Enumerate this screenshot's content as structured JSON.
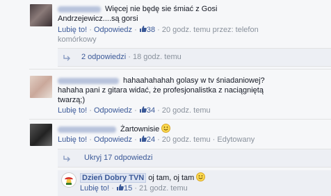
{
  "comments": [
    {
      "text_line1": "Więcej nie będę sie śmiać z Gosi",
      "text_line2": "Andrzejewicz....są gorsi",
      "like_label": "Lubię to!",
      "reply_label": "Odpowiedz",
      "likes": "38",
      "time": "20 godz. temu przez: telefon",
      "time_line2": "komórkowy",
      "replies_label": "2 odpowiedzi",
      "replies_time": "18 godz. temu"
    },
    {
      "text_line1": "hahaahahahah golasy w tv śniadaniowej?",
      "text_line2": "hahaha pani z gitara widać, że profesjonalistka z naciągniętą",
      "text_line3": "twarzą;)",
      "like_label": "Lubię to!",
      "reply_label": "Odpowiedz",
      "likes": "34",
      "time": "20 godz. temu"
    },
    {
      "text": "Żartownisie",
      "like_label": "Lubię to!",
      "reply_label": "Odpowiedz",
      "likes": "24",
      "time": "20 godz. temu",
      "edited": "Edytowany",
      "hide_replies_label": "Ukryj 17 odpowiedzi"
    }
  ],
  "nested_reply": {
    "author": "Dzień Dobry TVN",
    "text": "oj tam, oj tam",
    "like_label": "Lubię to!",
    "likes": "15",
    "time": "21 godz. temu"
  },
  "colors": {
    "link": "#3b5998",
    "meta": "#89919c",
    "background": "#f6f7f9",
    "reply_box": "#edeff4"
  },
  "icons": [
    "thumbs-up-icon",
    "reply-arrow-icon",
    "smiley-icon",
    "tvn-logo-icon"
  ]
}
